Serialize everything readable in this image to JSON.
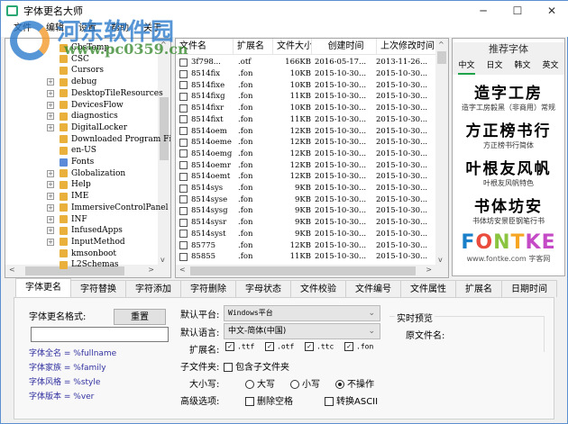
{
  "window": {
    "title": "字体更名大师",
    "controls": [
      "─",
      "☐",
      "✕"
    ]
  },
  "watermark": {
    "name": "河东软件园",
    "url": "www.pc0359.cn"
  },
  "menu": [
    "文件",
    "编辑",
    "设置",
    "帮助",
    "关于"
  ],
  "tree": [
    {
      "label": "CbsTemp",
      "expand": false
    },
    {
      "label": "CSC",
      "expand": false
    },
    {
      "label": "Cursors",
      "expand": false
    },
    {
      "label": "debug",
      "expand": true
    },
    {
      "label": "DesktopTileResources",
      "expand": true
    },
    {
      "label": "DevicesFlow",
      "expand": true
    },
    {
      "label": "diagnostics",
      "expand": true
    },
    {
      "label": "DigitalLocker",
      "expand": true
    },
    {
      "label": "Downloaded Program Files",
      "expand": false
    },
    {
      "label": "en-US",
      "expand": false
    },
    {
      "label": "Fonts",
      "expand": false,
      "special": true
    },
    {
      "label": "Globalization",
      "expand": true
    },
    {
      "label": "Help",
      "expand": true
    },
    {
      "label": "IME",
      "expand": true
    },
    {
      "label": "ImmersiveControlPanel",
      "expand": true
    },
    {
      "label": "INF",
      "expand": true
    },
    {
      "label": "InfusedApps",
      "expand": true
    },
    {
      "label": "InputMethod",
      "expand": true
    },
    {
      "label": "kmsonboot",
      "expand": false
    },
    {
      "label": "L2Schemas",
      "expand": false
    }
  ],
  "files": {
    "columns": [
      "文件名",
      "扩展名",
      "文件大小",
      "创建时间",
      "上次修改时间"
    ],
    "rows": [
      [
        "3f798...",
        ".otf",
        "166KB",
        "2016-05-17...",
        "2013-11-26..."
      ],
      [
        "8514fix",
        ".fon",
        "10KB",
        "2015-10-30...",
        "2015-10-30..."
      ],
      [
        "8514fixe",
        ".fon",
        "10KB",
        "2015-10-30...",
        "2015-10-30..."
      ],
      [
        "8514fixg",
        ".fon",
        "11KB",
        "2015-10-30...",
        "2015-10-30..."
      ],
      [
        "8514fixr",
        ".fon",
        "10KB",
        "2015-10-30...",
        "2015-10-30..."
      ],
      [
        "8514fixt",
        ".fon",
        "11KB",
        "2015-10-30...",
        "2015-10-30..."
      ],
      [
        "8514oem",
        ".fon",
        "12KB",
        "2015-10-30...",
        "2015-10-30..."
      ],
      [
        "8514oeme",
        ".fon",
        "12KB",
        "2015-10-30...",
        "2015-10-30..."
      ],
      [
        "8514oemg",
        ".fon",
        "12KB",
        "2015-10-30...",
        "2015-10-30..."
      ],
      [
        "8514oemr",
        ".fon",
        "12KB",
        "2015-10-30...",
        "2015-10-30..."
      ],
      [
        "8514oemt",
        ".fon",
        "12KB",
        "2015-10-30...",
        "2015-10-30..."
      ],
      [
        "8514sys",
        ".fon",
        "9KB",
        "2015-10-30...",
        "2015-10-30..."
      ],
      [
        "8514syse",
        ".fon",
        "9KB",
        "2015-10-30...",
        "2015-10-30..."
      ],
      [
        "8514sysg",
        ".fon",
        "9KB",
        "2015-10-30...",
        "2015-10-30..."
      ],
      [
        "8514sysr",
        ".fon",
        "9KB",
        "2015-10-30...",
        "2015-10-30..."
      ],
      [
        "8514syst",
        ".fon",
        "9KB",
        "2015-10-30...",
        "2015-10-30..."
      ],
      [
        "85775",
        ".fon",
        "12KB",
        "2015-10-30...",
        "2015-10-30..."
      ],
      [
        "85855",
        ".fon",
        "11KB",
        "2015-10-30...",
        "2015-10-30..."
      ]
    ]
  },
  "recommend": {
    "title": "推荐字体",
    "tabs": [
      "中文",
      "日文",
      "韩文",
      "英文"
    ],
    "fonts": [
      {
        "sample": "造字工房",
        "name": "造字工房毅黑（非商用）常规"
      },
      {
        "sample": "方正榜书行",
        "name": "方正榜书行简体"
      },
      {
        "sample": "叶根友风帆",
        "name": "叶根友风帆特色"
      },
      {
        "sample": "书体坊安",
        "name": "书体坊安景臣钢笔行书"
      }
    ],
    "brand": [
      "F",
      "O",
      "N",
      "T",
      "KE"
    ],
    "brand_url": "www.fontke.com 字客网"
  },
  "tabs": [
    "字体更名",
    "字符替换",
    "字符添加",
    "字符删除",
    "字母状态",
    "文件校验",
    "文件编号",
    "文件属性",
    "扩展名",
    "日期时间"
  ],
  "panel": {
    "format_label": "字体更名格式:",
    "reset": "重置",
    "format_value": "",
    "vars": [
      "字体全名 = %fullname",
      "字体家族 = %family",
      "字体风格 = %style",
      "字体版本 = %ver"
    ],
    "platform_label": "默认平台:",
    "platform": "Windows平台",
    "language_label": "默认语言:",
    "language": "中文-简体(中国)",
    "ext_label": "扩展名:",
    "exts": [
      ".ttf",
      ".otf",
      ".ttc",
      ".fon"
    ],
    "subfolder_label": "子文件夹:",
    "subfolder_option": "包含子文件夹",
    "case_label": "大小写:",
    "case_options": [
      "大写",
      "小写",
      "不操作"
    ],
    "case_selected": 2,
    "adv_label": "高级选项:",
    "adv_options": [
      "删除空格",
      "转换ASCII"
    ],
    "preview_title": "实时预览",
    "orig_label": "原文件名:"
  }
}
